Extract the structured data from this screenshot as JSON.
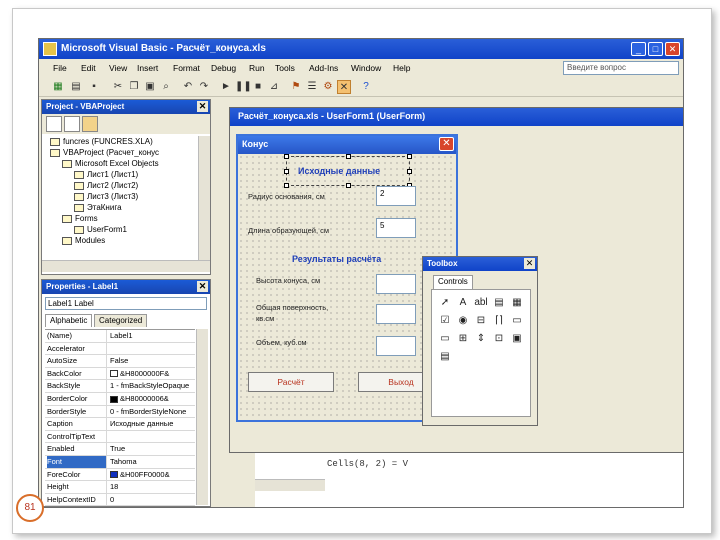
{
  "app": {
    "title": "Microsoft Visual Basic - Расчёт_конуса.xls",
    "window_buttons": [
      "_",
      "□",
      "✕"
    ]
  },
  "menu": {
    "items": [
      "File",
      "Edit",
      "View",
      "Insert",
      "Format",
      "Debug",
      "Run",
      "Tools",
      "Add-Ins",
      "Window",
      "Help"
    ],
    "ask_placeholder": "Введите вопрос"
  },
  "project": {
    "title": "Project - VBAProject",
    "tree": [
      "funcres (FUNCRES.XLA)",
      "VBAProject (Расчет_конус",
      "Microsoft Excel Objects",
      "Лист1 (Лист1)",
      "Лист2 (Лист2)",
      "Лист3 (Лист3)",
      "ЭтаКнига",
      "Forms",
      "UserForm1",
      "Modules"
    ]
  },
  "properties": {
    "title": "Properties - Label1",
    "object": "Label1 Label",
    "tabs": [
      "Alphabetic",
      "Categorized"
    ],
    "rows": [
      {
        "name": "(Name)",
        "value": "Label1"
      },
      {
        "name": "Accelerator",
        "value": ""
      },
      {
        "name": "AutoSize",
        "value": "False"
      },
      {
        "name": "BackColor",
        "value": "&H8000000F&"
      },
      {
        "name": "BackStyle",
        "value": "1 - fmBackStyleOpaque"
      },
      {
        "name": "BorderColor",
        "value": "&H80000006&"
      },
      {
        "name": "BorderStyle",
        "value": "0 - fmBorderStyleNone"
      },
      {
        "name": "Caption",
        "value": "Исходные данные"
      },
      {
        "name": "ControlTipText",
        "value": ""
      },
      {
        "name": "Enabled",
        "value": "True"
      },
      {
        "name": "Font",
        "value": "Tahoma"
      },
      {
        "name": "ForeColor",
        "value": "&H00FF0000&"
      },
      {
        "name": "Height",
        "value": "18"
      },
      {
        "name": "HelpContextID",
        "value": "0"
      }
    ],
    "selected_row": 10,
    "colors": {
      "BackColor": "#ffffff",
      "BorderColor": "#000000",
      "ForeColor": "#1030c0"
    }
  },
  "userform_window": {
    "title": "Расчёт_конуса.xls - UserForm1 (UserForm)",
    "form": {
      "caption": "Конус",
      "section1": "Исходные данные",
      "section2": "Результаты расчёта",
      "labels": {
        "radius": "Радиус основания, см",
        "generatrix": "Длина образующей, см",
        "height": "Высота конуса, см",
        "area": "Общая поверхность, кв.см",
        "volume": "Объем, куб.см"
      },
      "values": {
        "radius": "2",
        "generatrix": "5"
      },
      "buttons": {
        "calc": "Расчёт",
        "exit": "Выход"
      }
    }
  },
  "toolbox": {
    "title": "Toolbox",
    "tab": "Controls",
    "controls": [
      "➚",
      "A",
      "abl",
      "▤",
      "▦",
      "☑",
      "◉",
      "⊟",
      "⌈⌉",
      "▭",
      "▭",
      "⊞",
      "⇕",
      "⊡",
      "▣",
      "▤"
    ]
  },
  "code": {
    "line": "Cells(8, 2) = V"
  },
  "slide": {
    "number": "81"
  }
}
